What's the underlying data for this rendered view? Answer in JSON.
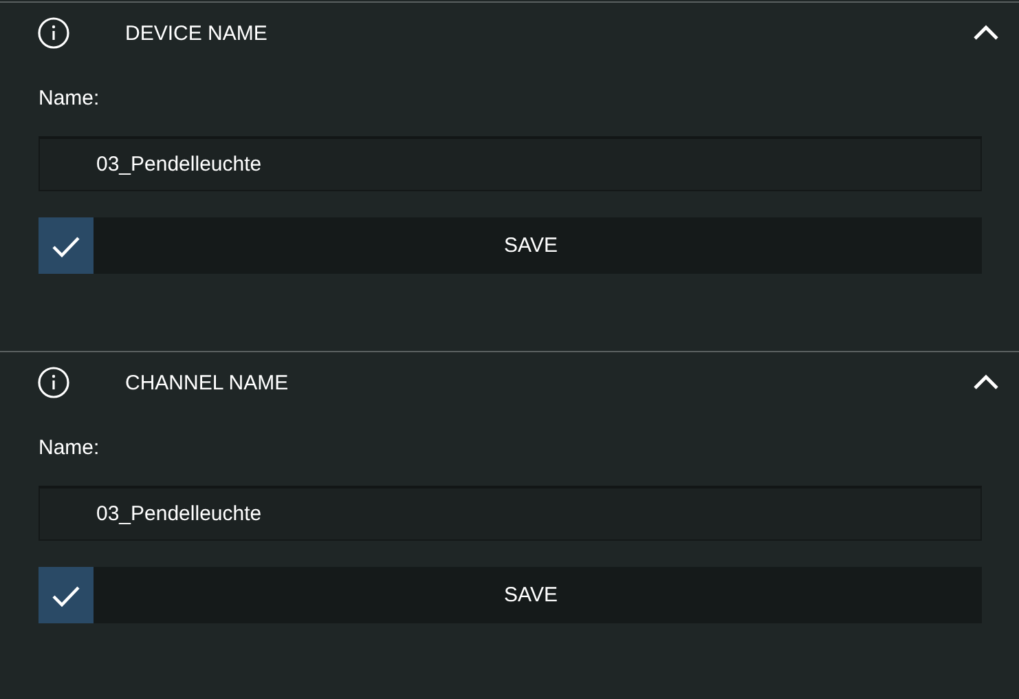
{
  "sections": [
    {
      "title": "DEVICE NAME",
      "expanded": true,
      "label": "Name:",
      "value": "03_Pendelleuchte",
      "button": "SAVE"
    },
    {
      "title": "CHANNEL NAME",
      "expanded": true,
      "label": "Name:",
      "value": "03_Pendelleuchte",
      "button": "SAVE"
    }
  ]
}
